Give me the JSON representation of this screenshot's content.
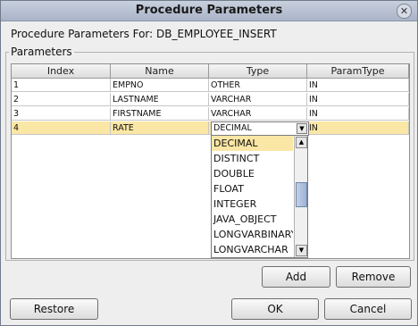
{
  "dialog": {
    "title": "Procedure Parameters",
    "close_icon": "close-icon"
  },
  "header": {
    "for_label": "Procedure Parameters For:  DB_EMPLOYEE_INSERT"
  },
  "group": {
    "label": "Parameters"
  },
  "table": {
    "columns": [
      "Index",
      "Name",
      "Type",
      "ParamType"
    ],
    "rows": [
      [
        "1",
        "EMPNO",
        "OTHER",
        "IN"
      ],
      [
        "2",
        "LASTNAME",
        "VARCHAR",
        "IN"
      ],
      [
        "3",
        "FIRSTNAME",
        "VARCHAR",
        "IN"
      ],
      [
        "4",
        "RATE",
        "DECIMAL",
        "IN"
      ]
    ],
    "selected_row": 4
  },
  "combo": {
    "value": "DECIMAL"
  },
  "dropdown": {
    "options": [
      "DECIMAL",
      "DISTINCT",
      "DOUBLE",
      "FLOAT",
      "INTEGER",
      "JAVA_OBJECT",
      "LONGVARBINARY",
      "LONGVARCHAR"
    ],
    "selected": "DECIMAL"
  },
  "buttons": {
    "add": "Add",
    "remove": "Remove",
    "restore": "Restore",
    "ok": "OK",
    "cancel": "Cancel"
  },
  "colors": {
    "selection": "#fbe7a5",
    "titlebar": "#aab4c8"
  }
}
